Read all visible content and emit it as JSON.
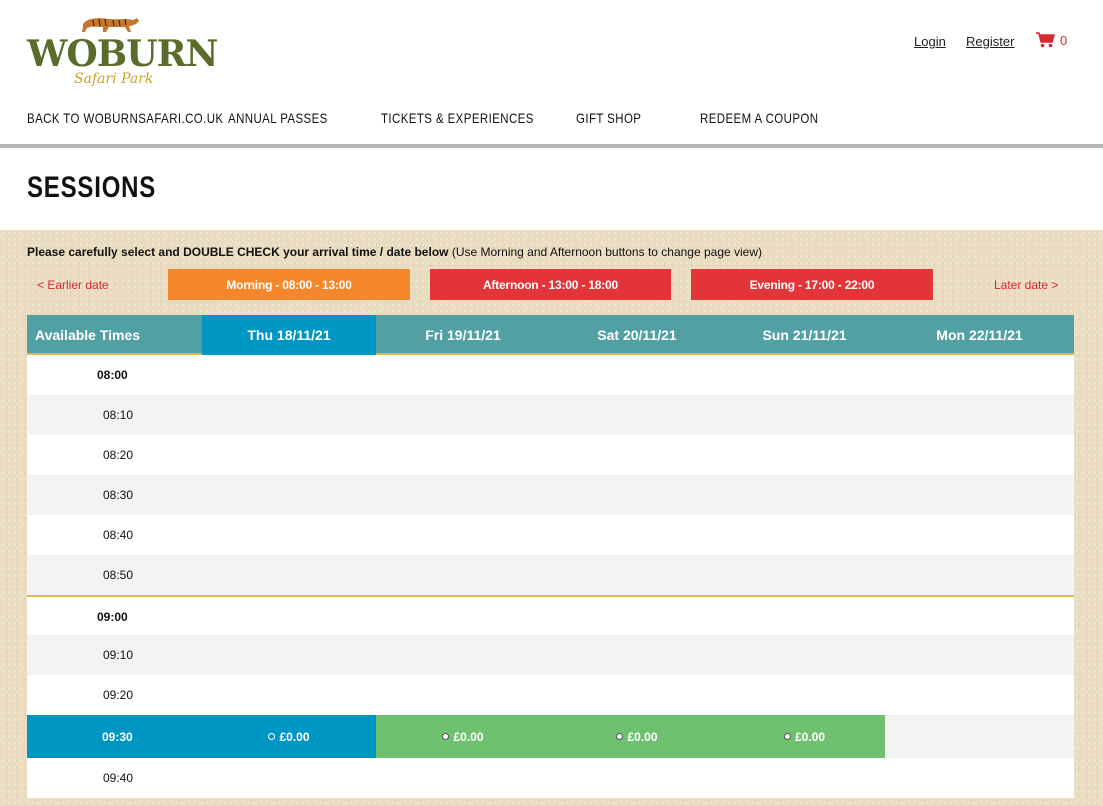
{
  "brand": {
    "name": "WOBURN",
    "sub": "Safari Park"
  },
  "account": {
    "login": "Login",
    "register": "Register",
    "cart_count": "0"
  },
  "nav": [
    "BACK TO WOBURNSAFARI.CO.UK",
    "ANNUAL PASSES",
    "TICKETS & EXPERIENCES",
    "GIFT SHOP",
    "REDEEM A COUPON"
  ],
  "page_title": "SESSIONS",
  "instructions": {
    "bold": "Please carefully select and DOUBLE CHECK your arrival time / date below",
    "normal": " (Use Morning and Afternoon buttons to change page view)"
  },
  "date_nav": {
    "earlier": "< Earlier date",
    "later": "Later date >"
  },
  "periods": {
    "morning": "Morning - 08:00 - 13:00",
    "afternoon": "Afternoon - 13:00 - 18:00",
    "evening": "Evening - 17:00 - 22:00"
  },
  "table": {
    "label_header": "Available Times",
    "days": [
      "Thu 18/11/21",
      "Fri 19/11/21",
      "Sat 20/11/21",
      "Sun 21/11/21",
      "Mon 22/11/21"
    ],
    "selected_day_index": 0,
    "times": [
      "08:00",
      "08:10",
      "08:20",
      "08:30",
      "08:40",
      "08:50",
      "09:00",
      "09:10",
      "09:20",
      "09:30",
      "09:40"
    ],
    "slot": {
      "time": "09:30",
      "prices": [
        "£0.00",
        "£0.00",
        "£0.00",
        "£0.00"
      ]
    }
  },
  "colors": {
    "header_teal": "#52a0a3",
    "selected_blue": "#0096c4",
    "available_green": "#6fc170",
    "morning_orange": "#f5862a",
    "period_red": "#e3343a",
    "link_red": "#d9282f",
    "gold_rule": "#d8bb57"
  }
}
